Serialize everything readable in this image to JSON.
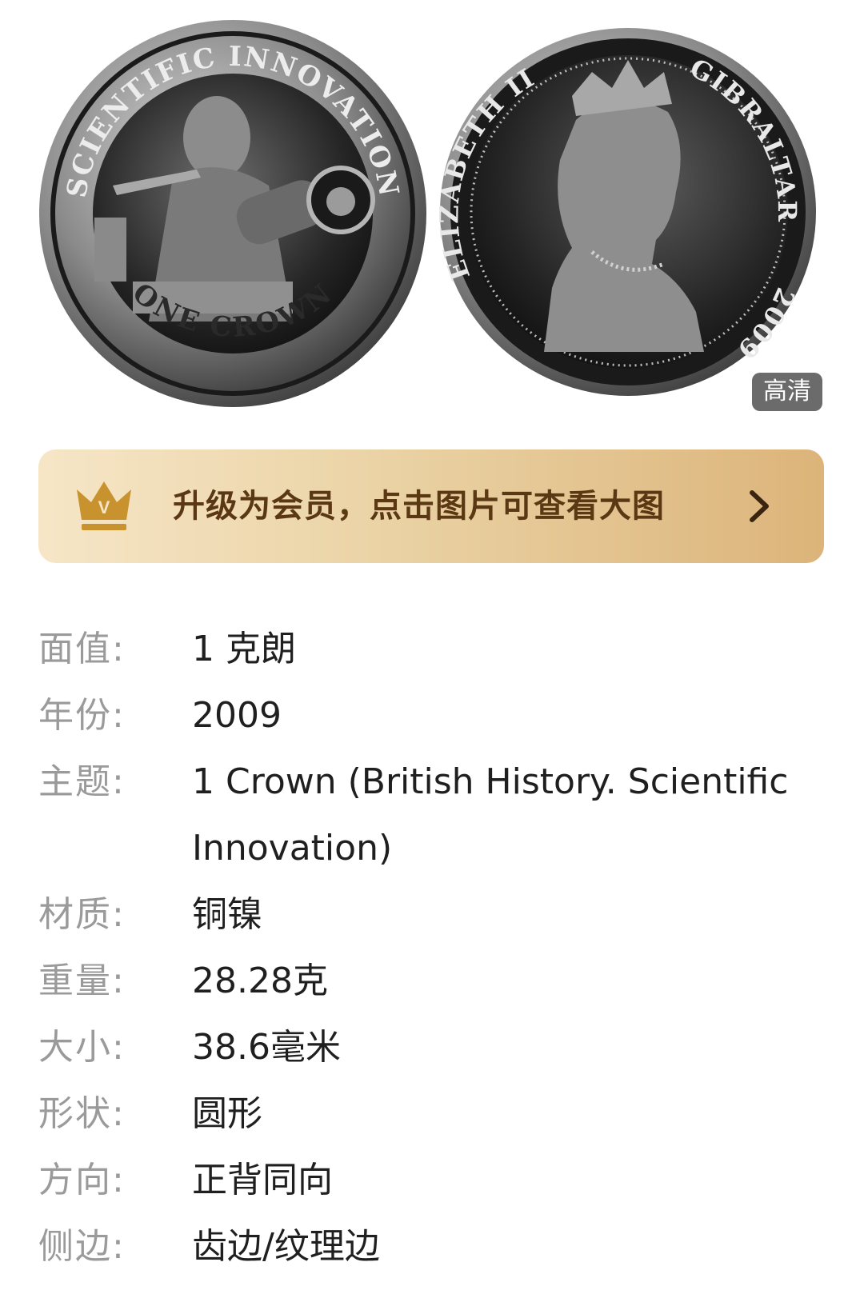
{
  "image": {
    "obverse_legend_top": "SCIENTIFIC INNOVATION",
    "obverse_legend_bottom": "ONE CROWN",
    "reverse_legend_left": "ELIZABETH II",
    "reverse_legend_right": "GIBRALTAR",
    "reverse_year": "2009",
    "hd_badge": "高清"
  },
  "vip_banner": {
    "crown_letter": "V",
    "text": "升级为会员，点击图片可查看大图",
    "colors": {
      "start": "#f6e6c7",
      "end": "#dcb47a",
      "text": "#5a3814",
      "crown": "#c8932f"
    }
  },
  "specs": [
    {
      "label": "面值:",
      "value": "1 克朗"
    },
    {
      "label": "年份:",
      "value": "2009"
    },
    {
      "label": "主题:",
      "value": "1 Crown (British History. Scientific Innovation)"
    },
    {
      "label": "材质:",
      "value": "铜镍"
    },
    {
      "label": "重量:",
      "value": "28.28克"
    },
    {
      "label": "大小:",
      "value": "38.6毫米"
    },
    {
      "label": "形状:",
      "value": "圆形"
    },
    {
      "label": "方向:",
      "value": "正背同向"
    },
    {
      "label": "侧边:",
      "value": "齿边/纹理边"
    }
  ]
}
